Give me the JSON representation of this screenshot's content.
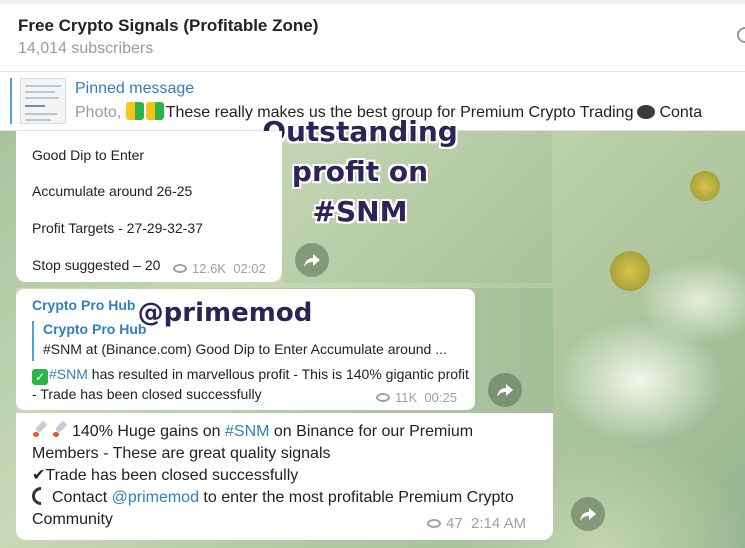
{
  "header": {
    "title": "Free Crypto Signals (Profitable Zone)",
    "subscribers": "14,014 subscribers"
  },
  "pinned": {
    "title": "Pinned message",
    "prefix": "Photo, ",
    "text": "These really makes us the best group for Premium Crypto Trading",
    "suffix": "Conta"
  },
  "overlay": {
    "line1": "Outstanding",
    "line2": "profit on",
    "line3": "#SNM",
    "handle": "@primemod"
  },
  "messages": [
    {
      "lines": [
        "Good Dip to Enter",
        "Accumulate around 26-25",
        "Profit Targets - 27-29-32-37",
        "Stop suggested – 20"
      ],
      "views": "12.6K",
      "time": "02:02"
    },
    {
      "author": "Crypto Pro Hub",
      "quote_author": "Crypto Pro Hub",
      "quote_text": "#SNM at (Binance.com)   Good Dip to Enter  Accumulate around ...",
      "hashtag": "#SNM",
      "text_after_hashtag": " has resulted in marvellous profit - This is 140% gigantic profit - Trade has been closed successfully",
      "views": "11K",
      "time": "00:25"
    },
    {
      "part1": "140% Huge gains on ",
      "hashtag": "#SNM",
      "part2": " on Binance for our Premium Members - These are great quality signals",
      "line2": "Trade has been closed successfully",
      "line3_a": "Contact ",
      "handle": "@primemod",
      "line3_b": " to enter the most profitable Premium Crypto Community",
      "views": "47",
      "time": "2:14 AM"
    }
  ]
}
